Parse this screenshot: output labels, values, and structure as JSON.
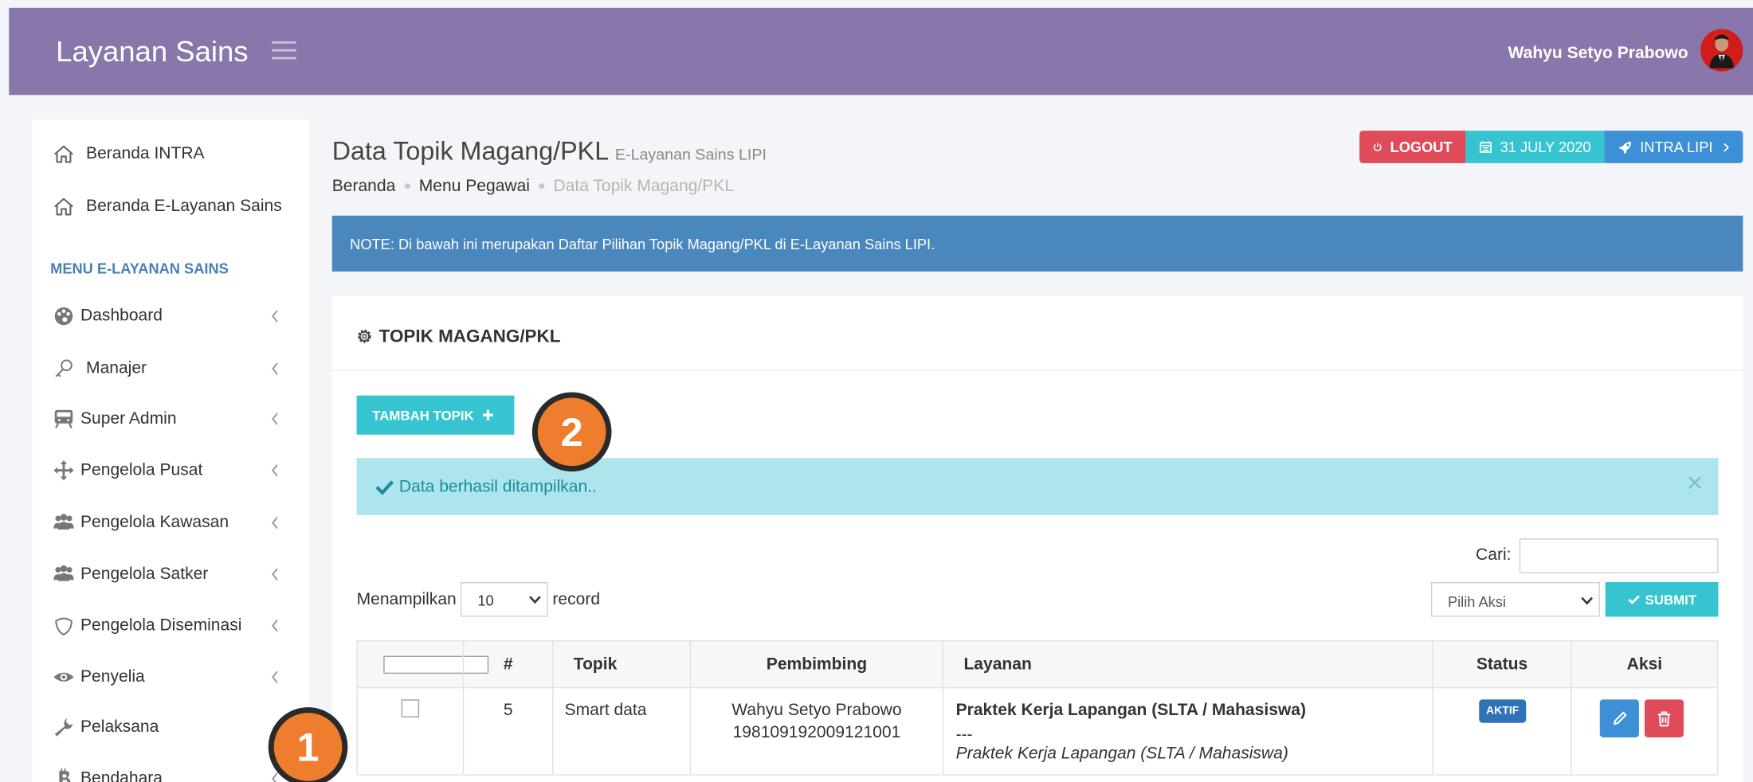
{
  "app": {
    "brand": "Layanan Sains",
    "user_name": "Wahyu Setyo Prabowo"
  },
  "sidebar": {
    "top_items": [
      {
        "label": "Beranda INTRA",
        "icon": "home-icon"
      },
      {
        "label": "Beranda E-Layanan Sains",
        "icon": "home-icon"
      }
    ],
    "section_header": "MENU E-LAYANAN SAINS",
    "menu_items": [
      {
        "label": "Dashboard",
        "icon": "palette-icon"
      },
      {
        "label": "Manajer",
        "icon": "key-icon"
      },
      {
        "label": "Super Admin",
        "icon": "server-icon"
      },
      {
        "label": "Pengelola Pusat",
        "icon": "arrows-icon"
      },
      {
        "label": "Pengelola Kawasan",
        "icon": "users-icon"
      },
      {
        "label": "Pengelola Satker",
        "icon": "users-icon"
      },
      {
        "label": "Pengelola Diseminasi",
        "icon": "shield-icon"
      },
      {
        "label": "Penyelia",
        "icon": "eye-icon"
      },
      {
        "label": "Pelaksana",
        "icon": "wrench-icon"
      },
      {
        "label": "Bendahara",
        "icon": "bitcoin-icon"
      }
    ]
  },
  "header": {
    "title": "Data Topik Magang/PKL",
    "subtitle": "E-Layanan Sains LIPI",
    "breadcrumb": [
      "Beranda",
      "Menu Pegawai",
      "Data Topik Magang/PKL"
    ],
    "logout_label": "LOGOUT",
    "date_label": "31 JULY 2020",
    "intra_label": "INTRA LIPI"
  },
  "note": "NOTE: Di bawah ini merupakan Daftar Pilihan Topik Magang/PKL di E-Layanan Sains LIPI.",
  "panel": {
    "title": "TOPIK MAGANG/PKL",
    "add_button": "TAMBAH TOPIK",
    "alert_message": "Data berhasil ditampilkan..",
    "search_label": "Cari:",
    "search_value": "",
    "show_label": "Menampilkan",
    "page_size": "10",
    "record_label": "record",
    "action_select": "Pilih Aksi",
    "submit_label": "SUBMIT"
  },
  "table": {
    "columns": [
      "#",
      "Topik",
      "Pembimbing",
      "Layanan",
      "Status",
      "Aksi"
    ],
    "rows": [
      {
        "number": "5",
        "topic": "Smart data",
        "supervisor_name": "Wahyu Setyo Prabowo",
        "supervisor_id": "198109192009121001",
        "service_title": "Praktek Kerja Lapangan (SLTA / Mahasiswa)",
        "service_separator": "---",
        "service_subtitle": "Praktek Kerja Lapangan (SLTA / Mahasiswa)",
        "status": "AKTIF"
      }
    ]
  },
  "markers": [
    "1",
    "2"
  ],
  "colors": {
    "topbar": "#8977ab",
    "note": "#4a87bd",
    "accent_teal": "#36c5d0",
    "alert_bg": "#ace5ec",
    "logout": "#e04b5a",
    "intra": "#3d8fd6",
    "badge": "#2f73b6",
    "marker": "#ee7d2e"
  }
}
